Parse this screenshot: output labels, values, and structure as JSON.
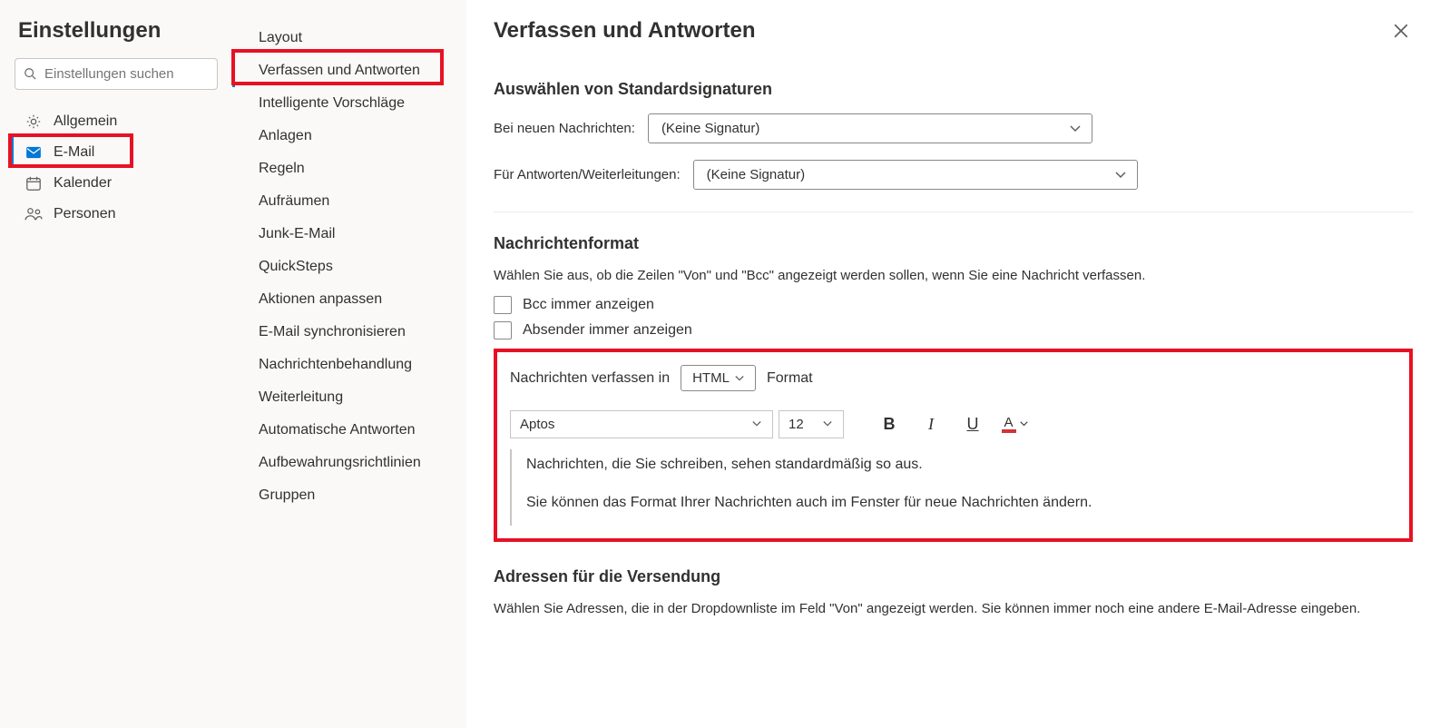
{
  "left": {
    "title": "Einstellungen",
    "search_placeholder": "Einstellungen suchen",
    "items": [
      {
        "label": "Allgemein",
        "icon": "gear"
      },
      {
        "label": "E-Mail",
        "icon": "mail",
        "active": true
      },
      {
        "label": "Kalender",
        "icon": "calendar"
      },
      {
        "label": "Personen",
        "icon": "people"
      }
    ]
  },
  "mid": {
    "items": [
      "Layout",
      "Verfassen und Antworten",
      "Intelligente Vorschläge",
      "Anlagen",
      "Regeln",
      "Aufräumen",
      "Junk-E-Mail",
      "QuickSteps",
      "Aktionen anpassen",
      "E-Mail synchronisieren",
      "Nachrichtenbehandlung",
      "Weiterleitung",
      "Automatische Antworten",
      "Aufbewahrungsrichtlinien",
      "Gruppen"
    ],
    "active_index": 1
  },
  "main": {
    "title": "Verfassen und Antworten",
    "sig_section_title": "Auswählen von Standardsignaturen",
    "sig_new_label": "Bei neuen Nachrichten:",
    "sig_new_value": "(Keine Signatur)",
    "sig_reply_label": "Für Antworten/Weiterleitungen:",
    "sig_reply_value": "(Keine Signatur)",
    "format_section_title": "Nachrichtenformat",
    "format_desc": "Wählen Sie aus, ob die Zeilen \"Von\" und \"Bcc\" angezeigt werden sollen, wenn Sie eine Nachricht verfassen.",
    "bcc_label": "Bcc immer anzeigen",
    "sender_label": "Absender immer anzeigen",
    "compose_in_prefix": "Nachrichten verfassen in",
    "compose_format_value": "HTML",
    "compose_in_suffix": "Format",
    "font_name": "Aptos",
    "font_size": "12",
    "preview_line1": "Nachrichten, die Sie schreiben, sehen standardmäßig so aus.",
    "preview_line2": "Sie können das Format Ihrer Nachrichten auch im Fenster für neue Nachrichten ändern.",
    "addr_section_title": "Adressen für die Versendung",
    "addr_desc": "Wählen Sie Adressen, die in der Dropdownliste im Feld \"Von\" angezeigt werden. Sie können immer noch eine andere E-Mail-Adresse eingeben."
  }
}
